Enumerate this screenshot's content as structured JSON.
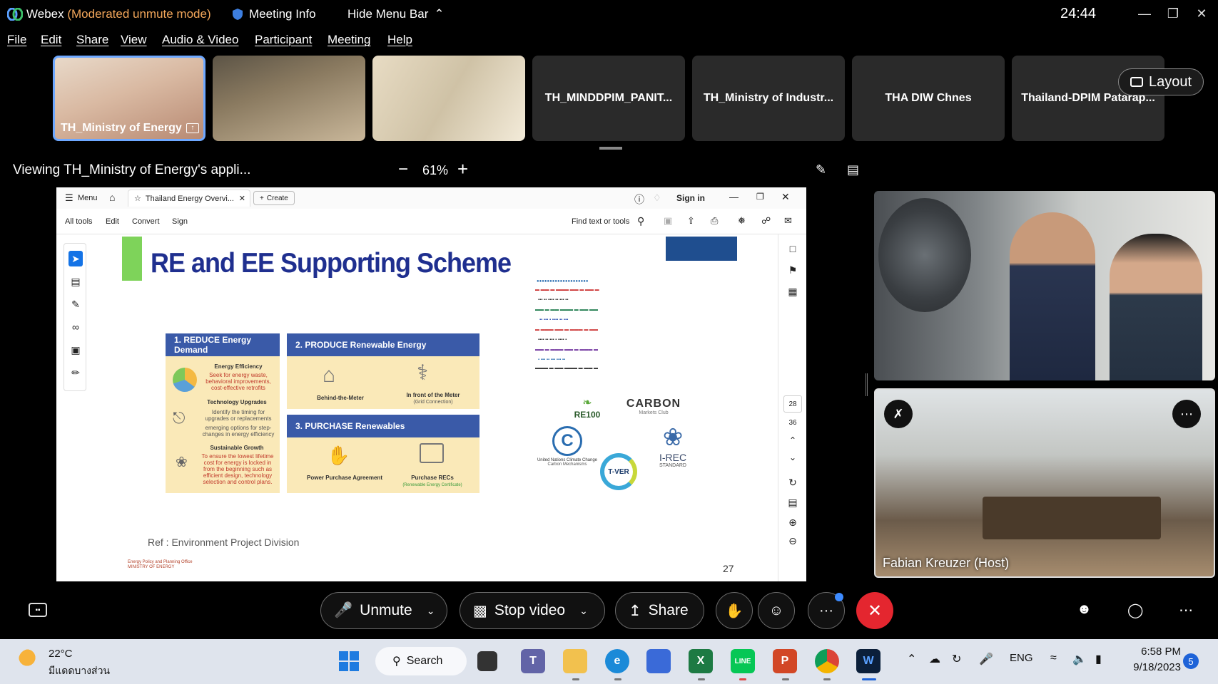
{
  "titlebar": {
    "app_name": "Webex",
    "mode": "(Moderated unmute mode)",
    "meeting_info": "Meeting Info",
    "hide_menu": "Hide Menu Bar",
    "timer": "24:44"
  },
  "menu": [
    "File",
    "Edit",
    "Share",
    "View",
    "Audio & Video",
    "Participant",
    "Meeting",
    "Help"
  ],
  "participants": [
    {
      "name": "TH_Ministry of Energy"
    },
    {
      "name": "TH_MINDDPIM_PANIT..."
    },
    {
      "name": "TH_Ministry of Industr..."
    },
    {
      "name": "THA DIW Chnes"
    },
    {
      "name": "Thailand-DPIM Patarap..."
    }
  ],
  "layout_label": "Layout",
  "viewing": {
    "title": "Viewing TH_Ministry of Energy's appli...",
    "zoom_minus": "−",
    "zoom": "61%",
    "zoom_plus": "+"
  },
  "acrobat": {
    "menu": "Menu",
    "tab_title": "Thailand Energy Overvi...",
    "create": "Create",
    "sign_in": "Sign in",
    "tools": [
      "All tools",
      "Edit",
      "Convert",
      "Sign"
    ],
    "find": "Find text or tools",
    "page_boxes": [
      "28",
      "36"
    ]
  },
  "slide": {
    "title": "RE and EE Supporting Scheme",
    "box1_head": "1. REDUCE Energy Demand",
    "box2_head": "2. PRODUCE Renewable Energy",
    "box3_head": "3. PURCHASE Renewables",
    "energy_eff": "Energy Efficiency",
    "energy_eff_desc": "Seek for energy waste, behavioral improvements, cost-effective retrofits",
    "tech_upgrades": "Technology Upgrades",
    "tech_desc1": "Identify the timing for upgrades or replacements",
    "tech_desc2": "emerging options for step-changes in energy efficiency",
    "sust_growth": "Sustainable Growth",
    "sust_desc": "To ensure the lowest lifetime cost for energy is locked in from the beginning such as efficient design, technology selection and control plans.",
    "behind_meter": "Behind-the-Meter",
    "front_meter": "In front of the Meter",
    "grid_conn": "(Grid Connection)",
    "ppa": "Power Purchase Agreement",
    "recs": "Purchase RECs",
    "recs_sub": "(Renewable Energy Certificate)",
    "re100": "RE100",
    "carbon": "CARBON",
    "carbon_sub": "Markets Club",
    "un_text": "United Nations Climate Change",
    "un_sub": "Carbon Mechanisms",
    "tver": "T-VER",
    "irec": "I-REC",
    "irec_sub": "STANDARD",
    "ref": "Ref : Environment Project Division",
    "page": "27",
    "ministry": "MINISTRY OF ENERGY",
    "ministry_office": "Energy Policy and Planning Office"
  },
  "host_label": "Fabian Kreuzer (Host)",
  "controls": {
    "unmute": "Unmute",
    "stop_video": "Stop video",
    "share": "Share",
    "more": "···",
    "end": "✕"
  },
  "taskbar": {
    "temp": "22°C",
    "weather": "มีแดดบางส่วน",
    "search": "Search",
    "lang": "ENG",
    "time": "6:58 PM",
    "date": "9/18/2023",
    "notifications": "5"
  }
}
